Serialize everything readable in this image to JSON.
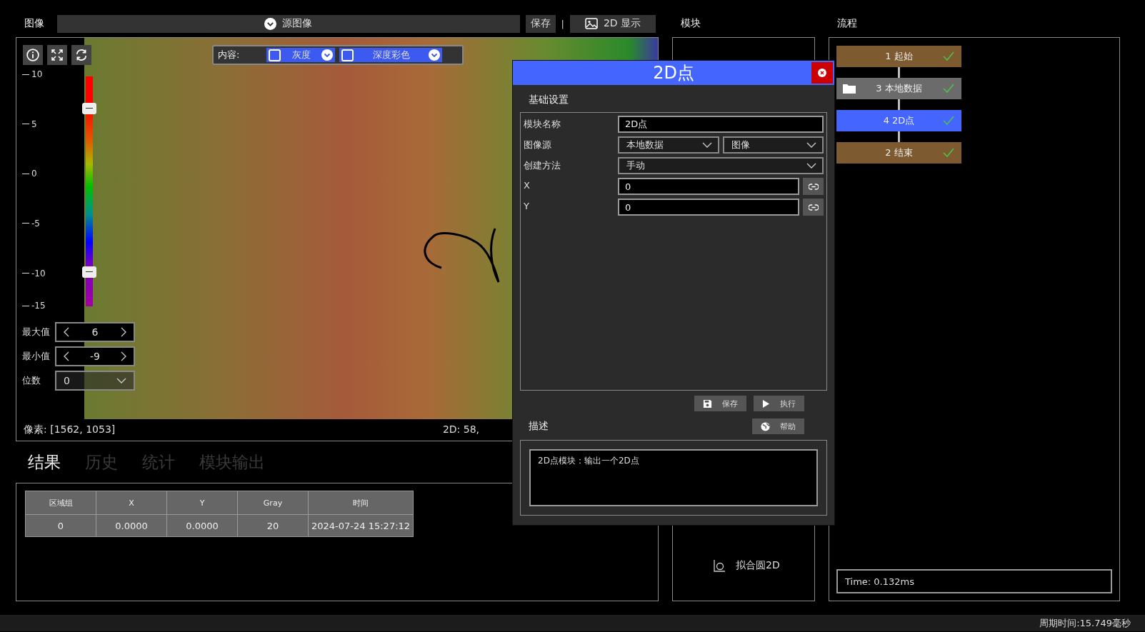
{
  "toolbar": {
    "label": "图像",
    "source": "源图像",
    "save": "保存",
    "separator": "|",
    "display": "2D 显示"
  },
  "viewer": {
    "content_label": "内容:",
    "options": [
      {
        "label": "灰度",
        "checked": false
      },
      {
        "label": "深度彩色",
        "checked": false
      }
    ],
    "scale_ticks": [
      "10",
      "5",
      "0",
      "-5",
      "-10",
      "-15"
    ],
    "handles": [
      {
        "level": 0.86
      },
      {
        "level": 0.15
      }
    ],
    "max": {
      "label": "最大值",
      "value": "6"
    },
    "min": {
      "label": "最小值",
      "value": "-9"
    },
    "digits": {
      "label": "位数",
      "value": "0"
    },
    "pixel": "像素: [1562, 1053]",
    "coord": "2D: 58,"
  },
  "result_tabs": [
    {
      "label": "结果",
      "selected": true
    },
    {
      "label": "历史",
      "selected": false
    },
    {
      "label": "统计",
      "selected": false
    },
    {
      "label": "模块输出",
      "selected": false
    }
  ],
  "table": {
    "columns": [
      "区域组",
      "X",
      "Y",
      "Gray",
      "时间"
    ],
    "rows": [
      [
        "0",
        "0.0000",
        "0.0000",
        "20",
        "2024-07-24 15:27:12"
      ]
    ]
  },
  "modules": {
    "title": "模块",
    "items": [
      {
        "label": "拟合圆2D"
      }
    ]
  },
  "flow": {
    "title": "流程",
    "nodes": [
      {
        "label": "1 起始",
        "kind": "start",
        "selected": false,
        "done": true
      },
      {
        "label": "3 本地数据",
        "kind": "data",
        "selected": false,
        "done": true
      },
      {
        "label": "4 2D点",
        "kind": "point",
        "selected": true,
        "done": true
      },
      {
        "label": "2 结束",
        "kind": "end",
        "selected": false,
        "done": true
      }
    ],
    "time": "Time: 0.132ms"
  },
  "dialog": {
    "title": "2D点",
    "section": "基础设置",
    "fields": [
      {
        "kind": "text",
        "label": "模块名称",
        "values": [
          "2D点"
        ]
      },
      {
        "kind": "select",
        "label": "图像源",
        "values": [
          "本地数据",
          "图像"
        ]
      },
      {
        "kind": "select",
        "label": "创建方法",
        "values": [
          "手动"
        ]
      },
      {
        "kind": "linked",
        "label": "X",
        "values": [
          "0"
        ]
      },
      {
        "kind": "linked",
        "label": "Y",
        "values": [
          "0"
        ]
      }
    ],
    "buttons": [
      {
        "kind": "save",
        "label": "保存"
      },
      {
        "kind": "run",
        "label": "执行"
      }
    ],
    "desc_title": "描述",
    "help": "帮助",
    "description": "2D点模块：输出一个2D点"
  },
  "status": "周期时间:15.749毫秒"
}
